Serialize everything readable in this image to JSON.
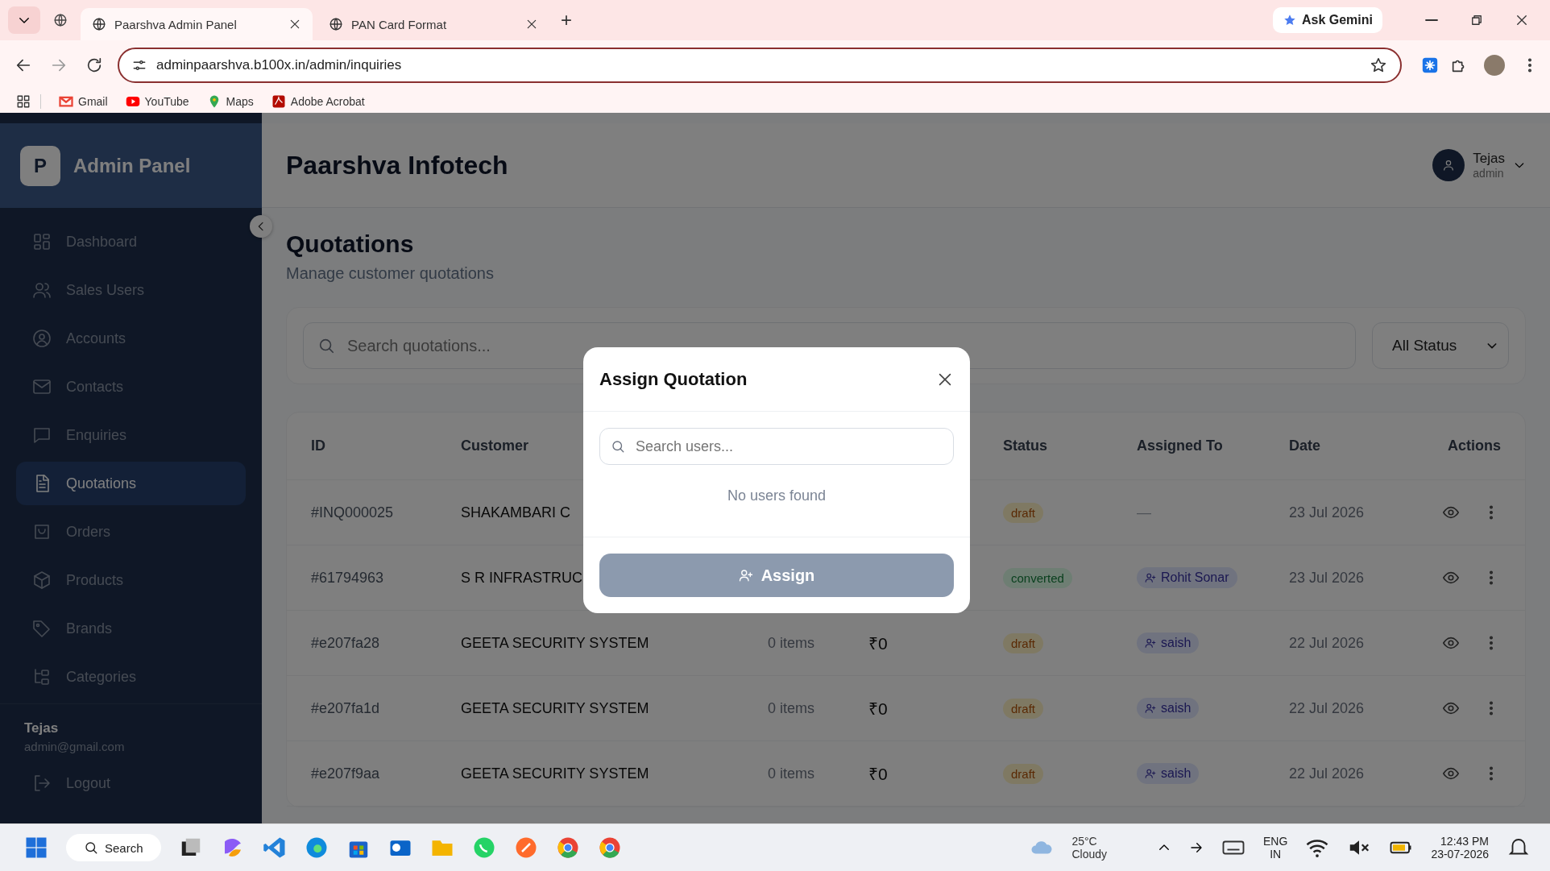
{
  "browser": {
    "tabs": [
      {
        "title": "Paarshva Admin Panel",
        "selected": true
      },
      {
        "title": "PAN Card Format",
        "selected": false
      }
    ],
    "new_tab": "+",
    "ask_gemini": "Ask Gemini",
    "url": "adminpaarshva.b100x.in/admin/inquiries",
    "bookmarks": [
      {
        "label": "Gmail",
        "kind": "mail"
      },
      {
        "label": "YouTube",
        "kind": "video"
      },
      {
        "label": "Maps",
        "kind": "map"
      },
      {
        "label": "Adobe Acrobat",
        "kind": "pdf"
      }
    ]
  },
  "sidebar": {
    "logo_letter": "P",
    "brand": "Admin Panel",
    "items": [
      {
        "label": "Dashboard",
        "kind": "grid",
        "selected": false
      },
      {
        "label": "Sales Users",
        "kind": "users",
        "selected": false
      },
      {
        "label": "Accounts",
        "kind": "account",
        "selected": false
      },
      {
        "label": "Contacts",
        "kind": "mail",
        "selected": false
      },
      {
        "label": "Enquiries",
        "kind": "chat",
        "selected": false
      },
      {
        "label": "Quotations",
        "kind": "doc",
        "selected": true
      },
      {
        "label": "Orders",
        "kind": "bag",
        "selected": false
      },
      {
        "label": "Products",
        "kind": "box",
        "selected": false
      },
      {
        "label": "Brands",
        "kind": "tag",
        "selected": false
      },
      {
        "label": "Categories",
        "kind": "tree",
        "selected": false
      }
    ],
    "user_name": "Tejas",
    "user_email": "admin@gmail.com",
    "logout": "Logout"
  },
  "header": {
    "title": "Paarshva Infotech",
    "user_name": "Tejas",
    "user_role": "admin"
  },
  "page": {
    "title": "Quotations",
    "subtitle": "Manage customer quotations",
    "search_placeholder": "Search quotations...",
    "status_filter": "All Status"
  },
  "table": {
    "columns": [
      "ID",
      "Customer",
      "Status",
      "Assigned To",
      "Date",
      "Actions"
    ],
    "rows": [
      {
        "id": "#INQ000025",
        "customer": "SHAKAMBARI C",
        "status": {
          "label": "draft",
          "kind": "draft"
        },
        "assigned_to": {
          "kind": "none",
          "label": "—"
        },
        "date": "23 Jul 2026"
      },
      {
        "id": "#61794963",
        "customer": "S R INFRASTRUC",
        "status": {
          "label": "converted",
          "kind": "converted"
        },
        "assigned_to": {
          "kind": "user",
          "label": "Rohit Sonar"
        },
        "date": "23 Jul 2026"
      },
      {
        "id": "#e207fa28",
        "customer": "GEETA SECURITY SYSTEM",
        "items": "0 items",
        "amount": "₹0",
        "status": {
          "label": "draft",
          "kind": "draft"
        },
        "assigned_to": {
          "kind": "user",
          "label": "saish"
        },
        "date": "22 Jul 2026"
      },
      {
        "id": "#e207fa1d",
        "customer": "GEETA SECURITY SYSTEM",
        "items": "0 items",
        "amount": "₹0",
        "status": {
          "label": "draft",
          "kind": "draft"
        },
        "assigned_to": {
          "kind": "user",
          "label": "saish"
        },
        "date": "22 Jul 2026"
      },
      {
        "id": "#e207f9aa",
        "customer": "GEETA SECURITY SYSTEM",
        "items": "0 items",
        "amount": "₹0",
        "status": {
          "label": "draft",
          "kind": "draft"
        },
        "assigned_to": {
          "kind": "user",
          "label": "saish"
        },
        "date": "22 Jul 2026"
      }
    ]
  },
  "modal": {
    "title": "Assign Quotation",
    "search_placeholder": "Search users...",
    "empty_text": "No users found",
    "button": "Assign",
    "button_disabled": true
  },
  "taskbar": {
    "search": "Search",
    "temperature": "25°C",
    "weather": "Cloudy",
    "language": "ENG",
    "region": "IN",
    "time": "12:43 PM",
    "date": "23-07-2026"
  }
}
